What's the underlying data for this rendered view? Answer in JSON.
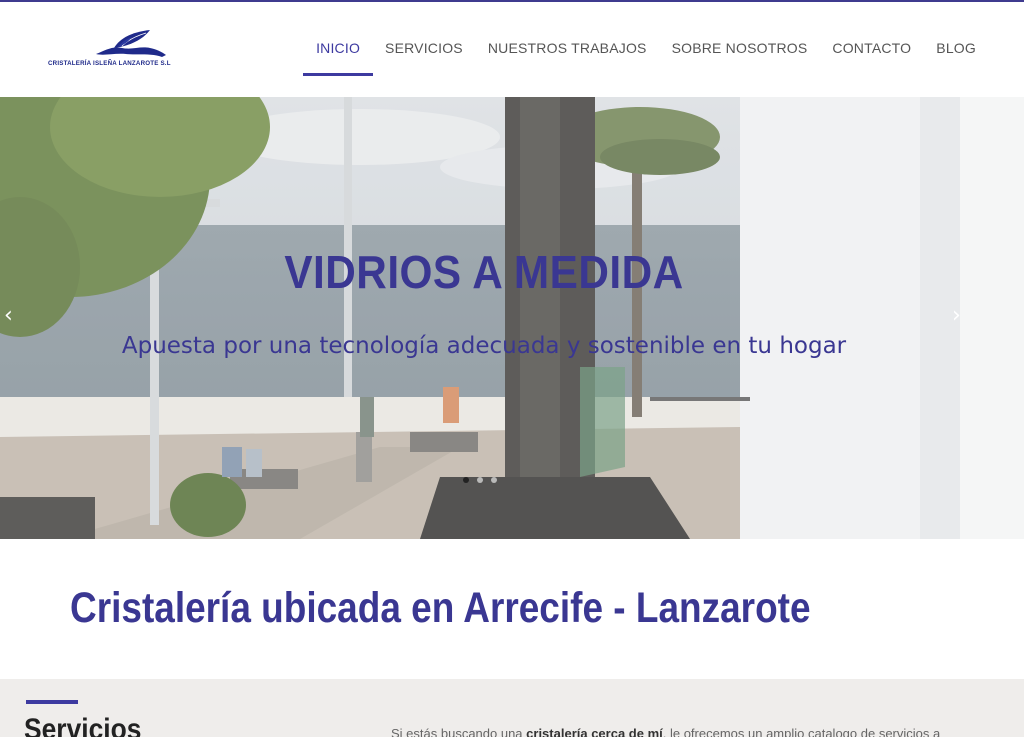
{
  "brand": {
    "name": "CRISTALERÍA ISLEÑA LANZAROTE S.L",
    "logo_icon": "leaf-on-island-logo",
    "color": "#1f2a8a"
  },
  "nav": {
    "items": [
      {
        "label": "INICIO",
        "active": true
      },
      {
        "label": "SERVICIOS"
      },
      {
        "label": "NUESTROS TRABAJOS"
      },
      {
        "label": "SOBRE NOSOTROS"
      },
      {
        "label": "CONTACTO"
      },
      {
        "label": "BLOG"
      }
    ],
    "accent": "#3d3aa0"
  },
  "hero": {
    "title": "VIDRIOS A MEDIDA",
    "subtitle": "Apuesta por una tecnología adecuada y sostenible en tu hogar",
    "prev_icon": "chevron-left-icon",
    "next_icon": "chevron-right-icon",
    "slides_count": 3,
    "active_slide": 1
  },
  "headline": "Cristalería ubicada en Arrecife - Lanzarote",
  "services": {
    "title": "Servicios",
    "intro_pre": "Si estás buscando una ",
    "intro_bold": "cristalería cerca de mí",
    "intro_post": ", le ofrecemos un amplio catalogo de servicios a"
  }
}
